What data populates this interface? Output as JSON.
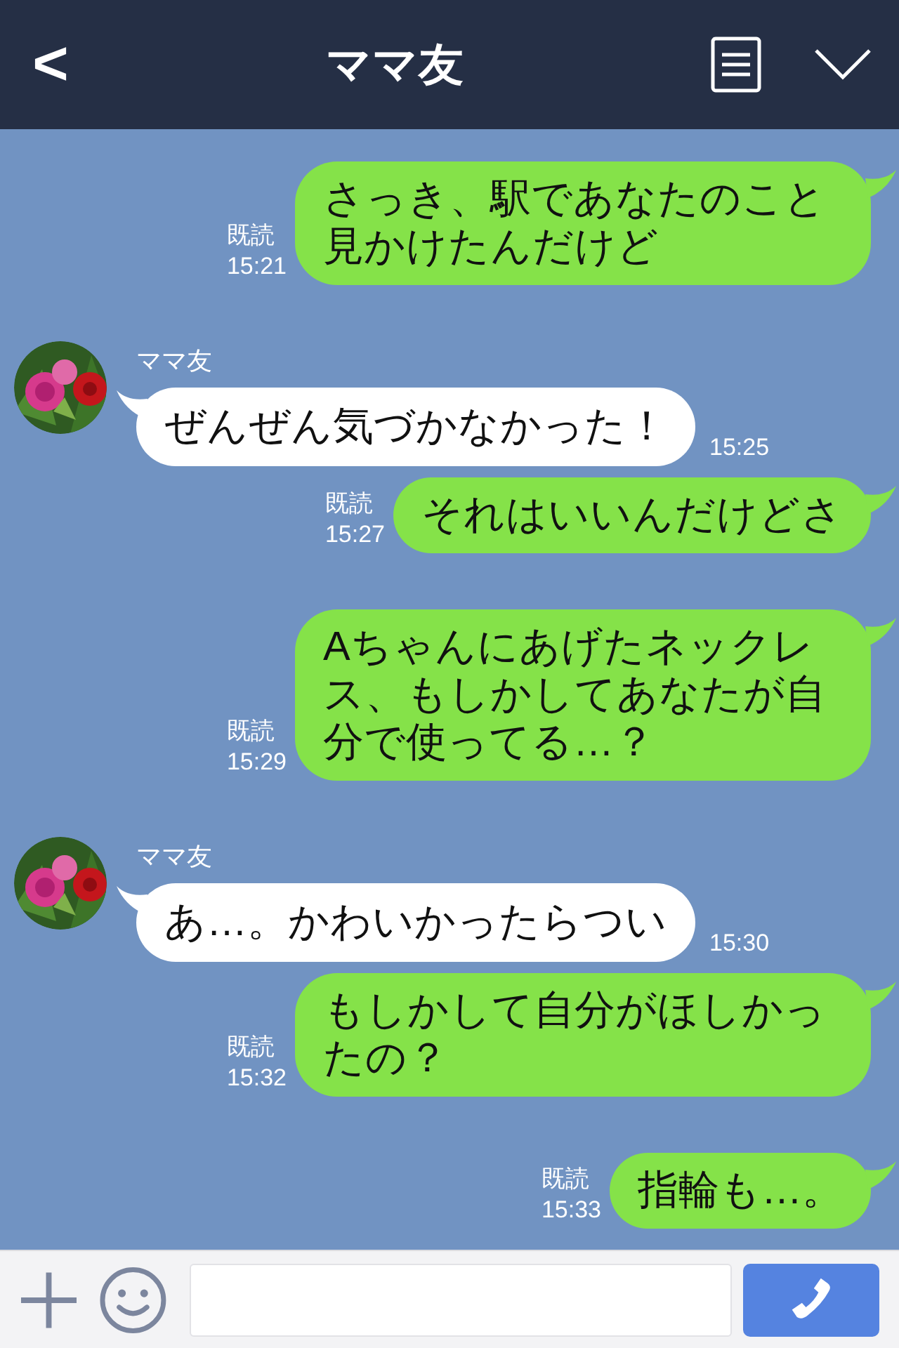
{
  "header": {
    "back": "<",
    "title": "ママ友"
  },
  "messages": [
    {
      "kind": "sent",
      "text": "さっき、駅であなたのこと見かけたんだけど",
      "read": "既読",
      "time": "15:21"
    },
    {
      "kind": "received",
      "sender": "ママ友",
      "text": "ぜんぜん気づかなかった！",
      "time": "15:25"
    },
    {
      "kind": "sent",
      "text": "それはいいんだけどさ",
      "read": "既読",
      "time": "15:27"
    },
    {
      "kind": "sent",
      "text": "Aちゃんにあげたネックレス、もしかしてあなたが自分で使ってる…？",
      "read": "既読",
      "time": "15:29"
    },
    {
      "kind": "received",
      "sender": "ママ友",
      "text": "あ…。かわいかったらつい",
      "time": "15:30"
    },
    {
      "kind": "sent",
      "text": "もしかして自分がほしかったの？",
      "read": "既読",
      "time": "15:32"
    },
    {
      "kind": "sent",
      "text": "指輪も…。",
      "read": "既読",
      "time": "15:33"
    }
  ]
}
